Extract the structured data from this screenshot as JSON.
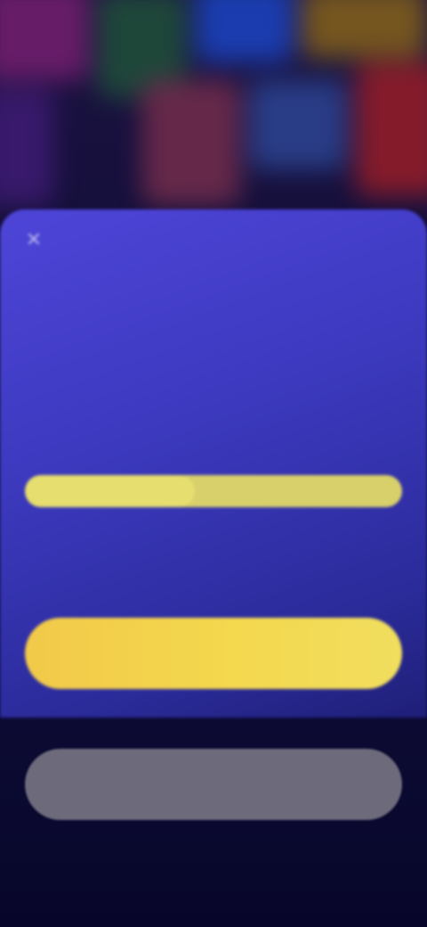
{
  "modal": {
    "close_icon": "close-icon",
    "title": "",
    "description": "",
    "progress_label": "",
    "progress_fraction": 0.45,
    "progress_text": "",
    "reward_text": "",
    "primary_button_label": "",
    "secondary_button_label": "",
    "footer_text": ""
  },
  "colors": {
    "card_top": "#4e45d8",
    "card_bottom": "#1f1f78",
    "primary_button": "#f4d84e",
    "progress_bar": "#d8d06b",
    "secondary_button": "#6d6a7c",
    "background": "#0b0a2e"
  },
  "background_tiles": [
    {
      "color": "#6b1d6a",
      "label": ""
    },
    {
      "color": "#1f4a3a",
      "label": ""
    },
    {
      "color": "#1b3fb5",
      "label": ""
    },
    {
      "color": "#7a5a1e",
      "label": ""
    },
    {
      "color": "#8a1c2a",
      "label": ""
    },
    {
      "color": "#3a1a6e",
      "label": ""
    },
    {
      "color": "#2a3f8a",
      "label": ""
    },
    {
      "color": "#6a2a4a",
      "label": ""
    }
  ]
}
